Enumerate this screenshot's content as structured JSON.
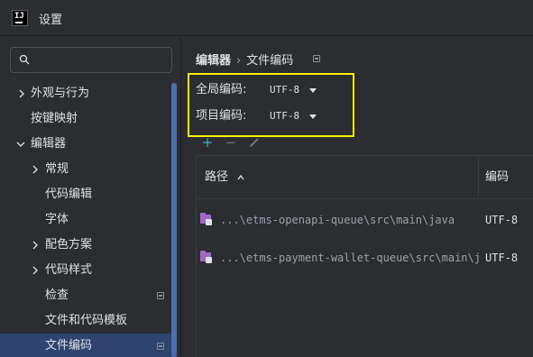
{
  "window": {
    "title": "设置",
    "logo_text": "IJ"
  },
  "sidebar": {
    "search": {
      "placeholder": ""
    },
    "items": [
      {
        "label": "外观与行为",
        "has_chevron": true,
        "expanded": false,
        "level": 0
      },
      {
        "label": "按键映射",
        "has_chevron": false,
        "level": 0
      },
      {
        "label": "编辑器",
        "has_chevron": true,
        "expanded": true,
        "level": 0
      },
      {
        "label": "常规",
        "has_chevron": true,
        "expanded": false,
        "level": 1
      },
      {
        "label": "代码编辑",
        "has_chevron": false,
        "level": 1
      },
      {
        "label": "字体",
        "has_chevron": false,
        "level": 1
      },
      {
        "label": "配色方案",
        "has_chevron": true,
        "expanded": false,
        "level": 1
      },
      {
        "label": "代码样式",
        "has_chevron": true,
        "expanded": false,
        "level": 1
      },
      {
        "label": "检查",
        "has_chevron": false,
        "level": 1,
        "project_icon": true
      },
      {
        "label": "文件和代码模板",
        "has_chevron": false,
        "level": 1
      },
      {
        "label": "文件编码",
        "has_chevron": false,
        "level": 1,
        "project_icon": true,
        "selected": true
      }
    ]
  },
  "main": {
    "breadcrumb": {
      "parent": "编辑器",
      "separator": "›",
      "current": "文件编码"
    },
    "global_encoding": {
      "label": "全局编码:",
      "value": "UTF-8"
    },
    "project_encoding": {
      "label": "项目编码:",
      "value": "UTF-8"
    },
    "toolbar": {
      "add": "+",
      "remove": "−",
      "edit": "edit-icon"
    },
    "table": {
      "columns": [
        "路径",
        "编码"
      ],
      "rows": [
        {
          "path": "...\\etms-openapi-queue\\src\\main\\java",
          "encoding": "UTF-8"
        },
        {
          "path": "...\\etms-payment-wallet-queue\\src\\main\\java",
          "encoding": "UTF-8"
        }
      ]
    }
  },
  "colors": {
    "background": "#2b2d30",
    "selection": "#2e436e",
    "accent": "#4b6eaf",
    "highlight_box": "#f3f100",
    "folder": "#a066c8",
    "add_button": "#3fb3c0"
  }
}
